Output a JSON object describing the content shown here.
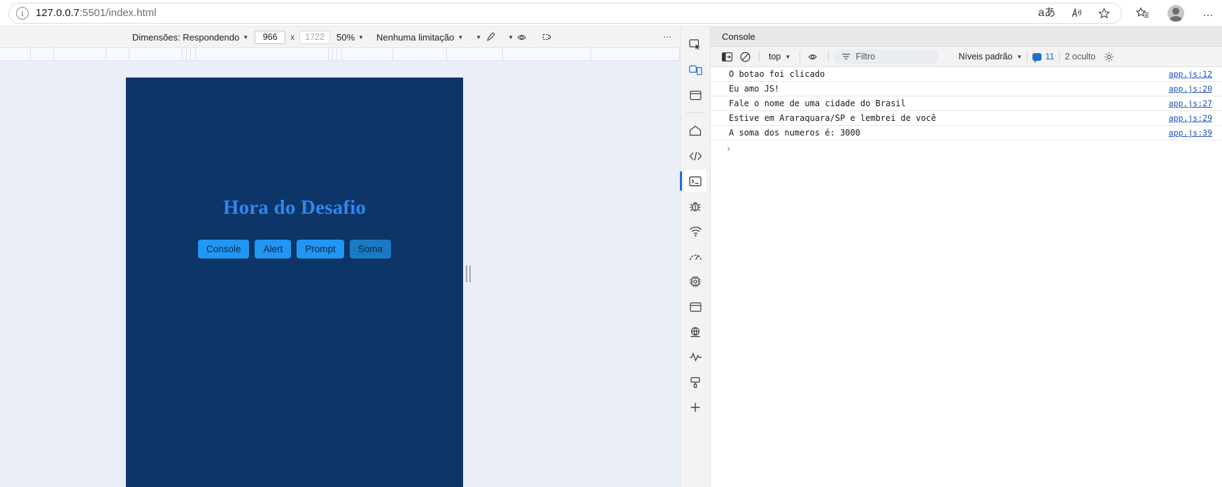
{
  "browser": {
    "url_host": "127.0.0.7",
    "url_rest": ":5501/index.html",
    "info_glyph": "i",
    "translate_icon": "aあ",
    "read_aloud_icon": "A",
    "favorite_icon": "☆",
    "collections_icon": "★",
    "profile_icon": "avatar",
    "settings_icon": "…"
  },
  "device_toolbar": {
    "dimensions_label": "Dimensões: Respondendo",
    "width_value": "966",
    "times_symbol": "x",
    "height_placeholder": "1722",
    "zoom_label": "50%",
    "throttling_label": "Nenhuma limitação",
    "rotate_icon": "rotate-icon",
    "eyedropper_icon": "eyedropper-icon",
    "vision_icon": "vision-deficiency-icon",
    "screenshot_icon": "screenshot-icon",
    "more_icon": "⋮"
  },
  "page": {
    "title": "Hora do Desafio",
    "buttons": [
      {
        "label": "Console",
        "state": "normal"
      },
      {
        "label": "Alert",
        "state": "normal"
      },
      {
        "label": "Prompt",
        "state": "normal"
      },
      {
        "label": "Soma",
        "state": "hovered"
      }
    ],
    "hero_bg": "#0d3567",
    "title_color": "#2f86f0",
    "button_color": "#2196f3",
    "button_hover_color": "#1b7ac4"
  },
  "activity_bar": {
    "items": [
      {
        "name": "inspect-element-icon",
        "active": false,
        "accent": false
      },
      {
        "name": "device-toolbar-icon",
        "active": false,
        "accent": true
      },
      {
        "name": "elements-panel-icon",
        "active": false,
        "accent": false
      },
      {
        "name": "welcome-home-icon",
        "active": false,
        "accent": false
      },
      {
        "name": "sources-code-icon",
        "active": false,
        "accent": false
      },
      {
        "name": "console-terminal-icon",
        "active": true,
        "accent": false
      },
      {
        "name": "debugger-bug-icon",
        "active": false,
        "accent": false
      },
      {
        "name": "network-wifi-icon",
        "active": false,
        "accent": false
      },
      {
        "name": "performance-gauge-icon",
        "active": false,
        "accent": false
      },
      {
        "name": "memory-chip-icon",
        "active": false,
        "accent": false
      },
      {
        "name": "application-storage-icon",
        "active": false,
        "accent": false
      },
      {
        "name": "security-globe-icon",
        "active": false,
        "accent": false
      },
      {
        "name": "performance-monitor-icon",
        "active": false,
        "accent": false
      },
      {
        "name": "css-paint-icon",
        "active": false,
        "accent": false
      },
      {
        "name": "add-panel-icon",
        "active": false,
        "accent": false
      }
    ]
  },
  "console": {
    "tab_label": "Console",
    "sidebar_toggle_icon": "sidebar-toggle-icon",
    "clear_icon": "clear-console-icon",
    "context_label": "top",
    "live_expression_icon": "eye-icon",
    "filter_placeholder": "Filtro",
    "levels_label": "Níveis padrão",
    "message_count": "11",
    "hidden_label": "2 oculto",
    "settings_icon": "gear-icon",
    "prompt_caret": "›",
    "logs": [
      {
        "text": "O botao foi clicado",
        "source": "app.js:12"
      },
      {
        "text": "Eu amo JS!",
        "source": "app.js:20"
      },
      {
        "text": "Fale o nome de uma cidade do Brasil",
        "source": "app.js:27"
      },
      {
        "text": "Estive em Araraquara/SP e lembrei de você",
        "source": "app.js:29"
      },
      {
        "text": "A soma dos numeros é: 3000",
        "source": "app.js:39"
      }
    ]
  },
  "ruler": {
    "segments": [
      64,
      48,
      110,
      48,
      112,
      8,
      8,
      10,
      280,
      8,
      8,
      10,
      108,
      112,
      118,
      185,
      186
    ]
  }
}
